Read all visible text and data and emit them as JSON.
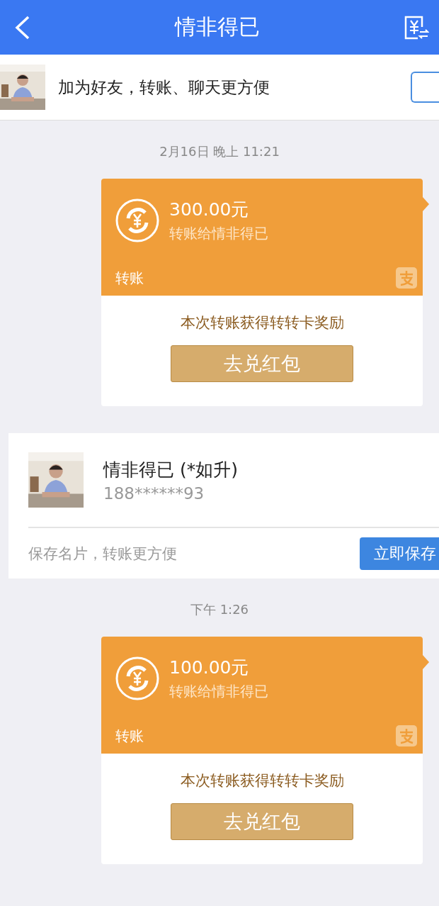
{
  "header": {
    "title": "情非得已"
  },
  "friend_banner": {
    "text": "加为好友，转账、聊天更方便"
  },
  "messages": [
    {
      "kind": "transfer",
      "time": "2月16日 晚上 11:21",
      "amount": "300.00元",
      "recipient": "转账给情非得已",
      "label": "转账",
      "reward": "本次转账获得转转卡奖励",
      "button": "去兑红包"
    },
    {
      "kind": "contact",
      "name": "情非得已 (*如升)",
      "phone": "188******93",
      "hint": "保存名片，转账更方便",
      "button": "立即保存"
    },
    {
      "kind": "transfer",
      "time": "下午 1:26",
      "amount": "100.00元",
      "recipient": "转账给情非得已",
      "label": "转账",
      "reward": "本次转账获得转转卡奖励",
      "button": "去兑红包"
    }
  ]
}
